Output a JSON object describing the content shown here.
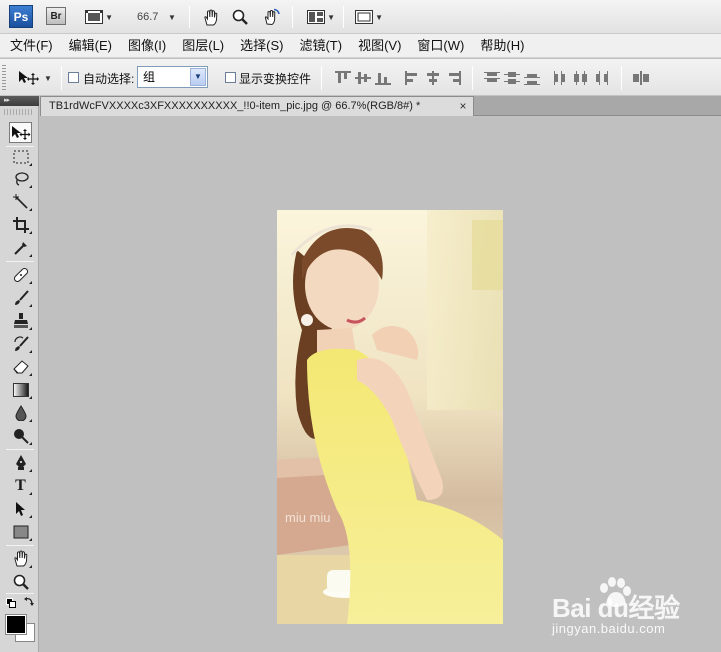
{
  "appbar": {
    "ps_logo": "Ps",
    "br_logo": "Br",
    "zoom": "66.7",
    "icons": [
      "film-strip-icon",
      "hand-icon",
      "zoom-icon",
      "rotate-view-icon",
      "arrange-documents-icon",
      "screen-mode-icon"
    ]
  },
  "menu": {
    "items": [
      "文件(F)",
      "编辑(E)",
      "图像(I)",
      "图层(L)",
      "选择(S)",
      "滤镜(T)",
      "视图(V)",
      "窗口(W)",
      "帮助(H)"
    ]
  },
  "options": {
    "auto_select_label": "自动选择:",
    "auto_select_value": "组",
    "show_transform_label": "显示变换控件",
    "auto_select_checked": false,
    "show_transform_checked": false
  },
  "tabbar": {
    "panel_toggle": "▸▸",
    "document_title": "TB1rdWcFVXXXXc3XFXXXXXXXXXX_!!0-item_pic.jpg @ 66.7%(RGB/8#) *",
    "close": "×"
  },
  "tools": [
    "move-tool",
    "marquee-tool",
    "lasso-tool",
    "magic-wand-tool",
    "crop-tool",
    "eyedropper-tool",
    "healing-brush-tool",
    "brush-tool",
    "clone-stamp-tool",
    "history-brush-tool",
    "eraser-tool",
    "gradient-tool",
    "blur-tool",
    "dodge-tool",
    "pen-tool",
    "type-tool",
    "path-selection-tool",
    "rectangle-tool",
    "hand-tool",
    "zoom-tool"
  ],
  "type_tool_glyph": "T",
  "colors": {
    "foreground": "#000000",
    "background": "#ffffff",
    "canvas": "#c0c0c0"
  },
  "photo": {
    "sign_text": "miu miu"
  },
  "watermark": {
    "logo": "Bai du经验",
    "url": "jingyan.baidu.com"
  }
}
